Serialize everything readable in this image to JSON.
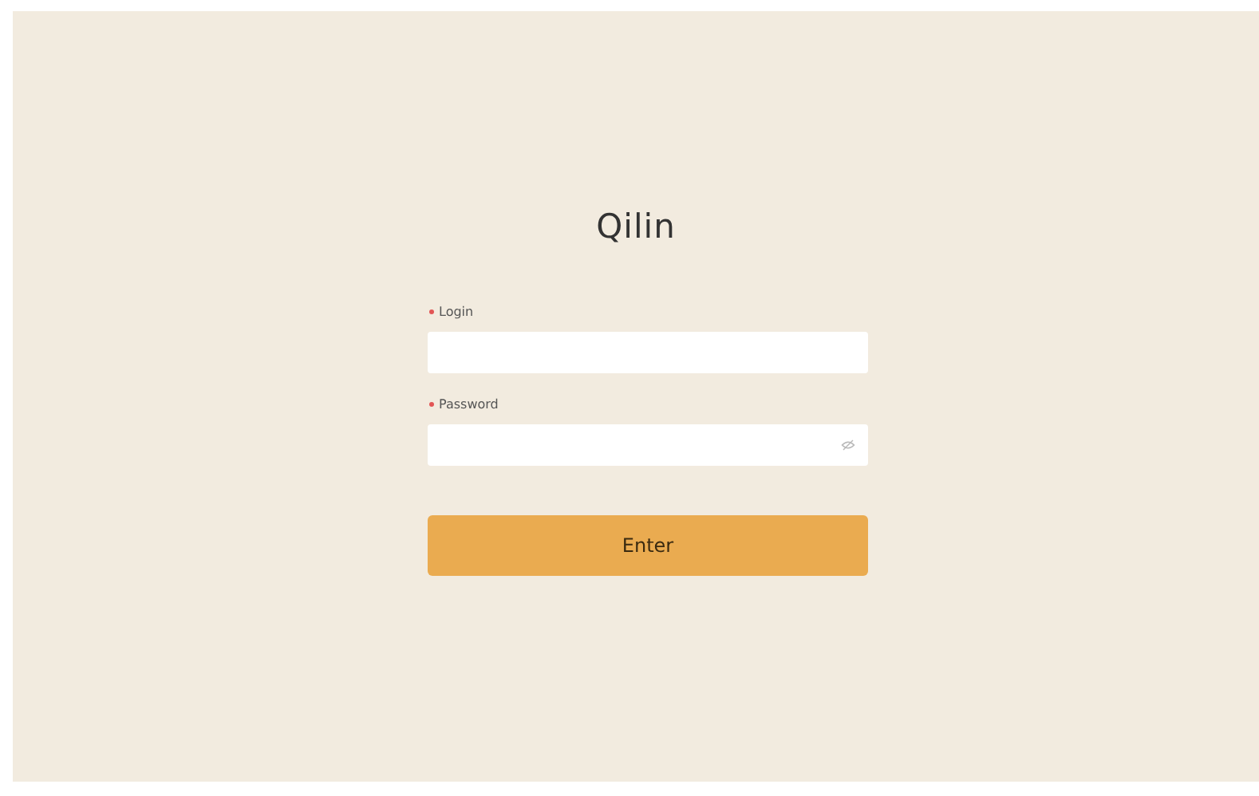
{
  "title": "Qilin",
  "fields": [
    {
      "label": "Login",
      "required": true,
      "kind": "text"
    },
    {
      "label": "Password",
      "required": true,
      "kind": "password"
    }
  ],
  "button": "Enter"
}
